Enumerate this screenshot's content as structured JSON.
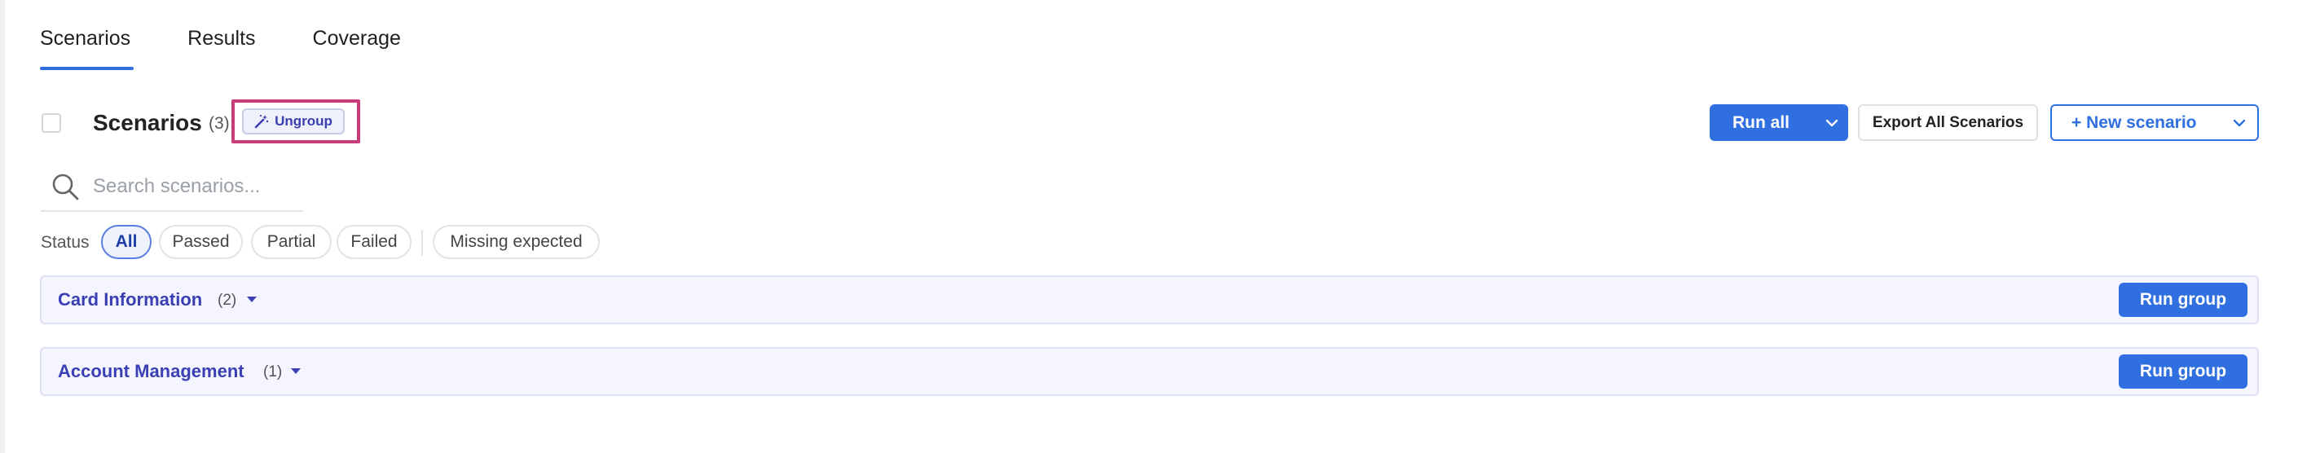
{
  "tabs": [
    {
      "label": "Scenarios",
      "active": true
    },
    {
      "label": "Results",
      "active": false
    },
    {
      "label": "Coverage",
      "active": false
    }
  ],
  "header": {
    "title": "Scenarios",
    "count": "(3)",
    "ungroup_label": "Ungroup",
    "ungroup_icon": "magic-wand-icon"
  },
  "actions": {
    "run_all_label": "Run all",
    "export_label": "Export All Scenarios",
    "new_scenario_label": "+ New scenario"
  },
  "search": {
    "placeholder": "Search scenarios...",
    "value": ""
  },
  "filters": {
    "label": "Status",
    "options": [
      "All",
      "Passed",
      "Partial",
      "Failed",
      "Missing expected"
    ],
    "selected": "All"
  },
  "groups": [
    {
      "name": "Card Information",
      "count": "(2)",
      "button_label": "Run group"
    },
    {
      "name": "Account Management",
      "count": "(1)",
      "button_label": "Run group"
    }
  ],
  "colors": {
    "accent": "#2f6fe0",
    "group_title": "#3b3fb4",
    "group_bg": "#f4f5fe",
    "highlight": "#c93c7a"
  }
}
